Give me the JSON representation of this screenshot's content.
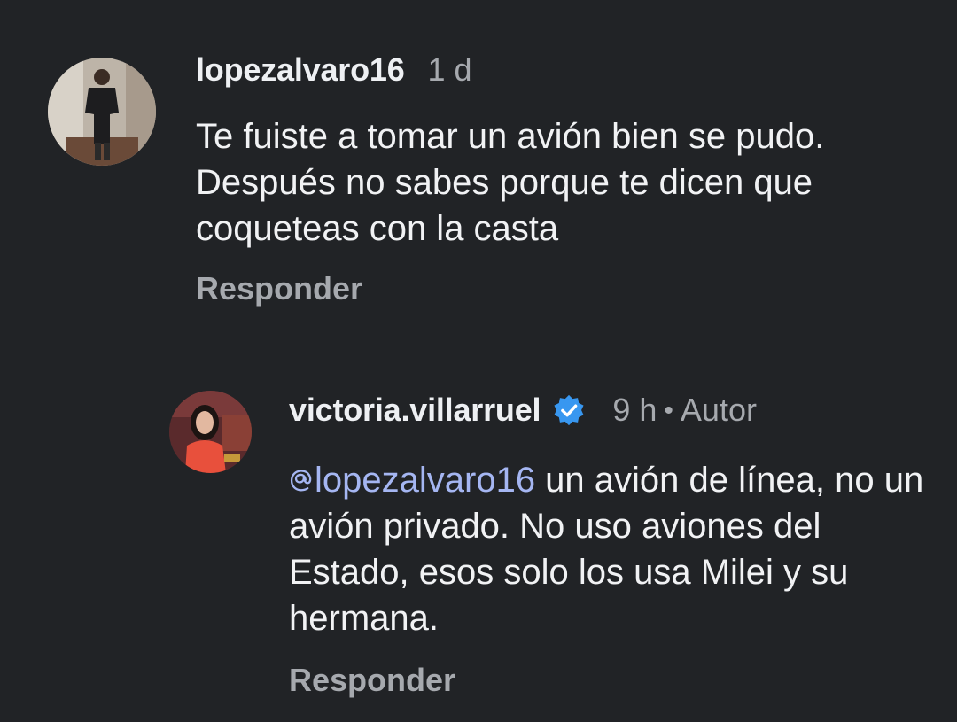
{
  "comments": [
    {
      "username": "lopezalvaro16",
      "time": "1 d",
      "text": "Te fuiste a tomar un avión bien se pudo. Después no sabes porque te dicen que coqueteas con la casta",
      "reply_label": "Responder",
      "avatar_icon": "profile-photo"
    },
    {
      "username": "victoria.villarruel",
      "verified_icon": "verified-badge-icon",
      "time": "9 h",
      "separator": "•",
      "author_badge": "Autor",
      "mention": "lopezalvaro16",
      "mention_icon": "threads-at-icon",
      "text": " un avión de línea, no un avión privado. No uso aviones del Estado, esos solo los usa Milei y su hermana.",
      "reply_label": "Responder",
      "avatar_icon": "profile-photo"
    }
  ],
  "colors": {
    "background": "#212326",
    "text": "#f1f2f4",
    "muted": "#a6a9ae",
    "mention": "#a5b6f2",
    "verified": "#3897f0"
  }
}
